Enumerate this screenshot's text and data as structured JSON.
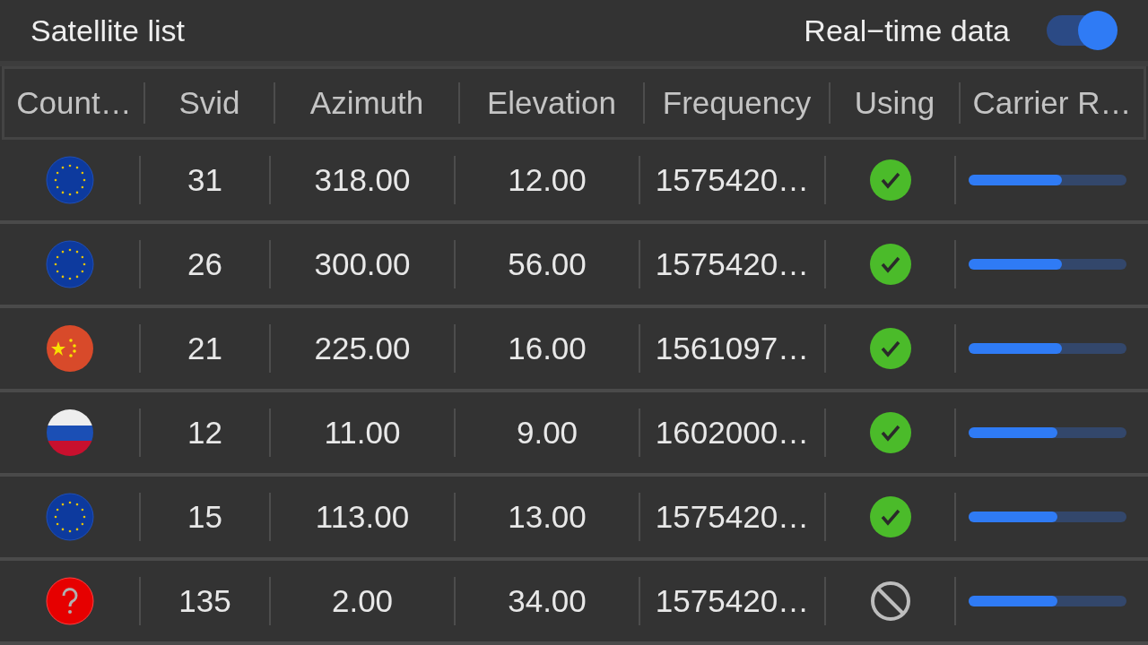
{
  "header": {
    "title": "Satellite list",
    "toggle_label": "Real−time data",
    "toggle_on": true
  },
  "table": {
    "columns": [
      "Count…",
      "Svid",
      "Azimuth",
      "Elevation",
      "Frequency",
      "Using",
      "Carrier R…"
    ],
    "rows": [
      {
        "kind": "eu",
        "svid": "31",
        "azimuth": "318.00",
        "elevation": "12.00",
        "frequency": "1575420…",
        "using": true,
        "level": 0.59
      },
      {
        "kind": "eu",
        "svid": "26",
        "azimuth": "300.00",
        "elevation": "56.00",
        "frequency": "1575420…",
        "using": true,
        "level": 0.59
      },
      {
        "kind": "cn",
        "svid": "21",
        "azimuth": "225.00",
        "elevation": "16.00",
        "frequency": "1561097…",
        "using": true,
        "level": 0.59
      },
      {
        "kind": "ru",
        "svid": "12",
        "azimuth": "11.00",
        "elevation": "9.00",
        "frequency": "1602000…",
        "using": true,
        "level": 0.56
      },
      {
        "kind": "eu",
        "svid": "15",
        "azimuth": "113.00",
        "elevation": "13.00",
        "frequency": "1575420…",
        "using": true,
        "level": 0.56
      },
      {
        "kind": "unknown",
        "svid": "135",
        "azimuth": "2.00",
        "elevation": "34.00",
        "frequency": "1575420…",
        "using": false,
        "level": 0.56
      }
    ]
  }
}
